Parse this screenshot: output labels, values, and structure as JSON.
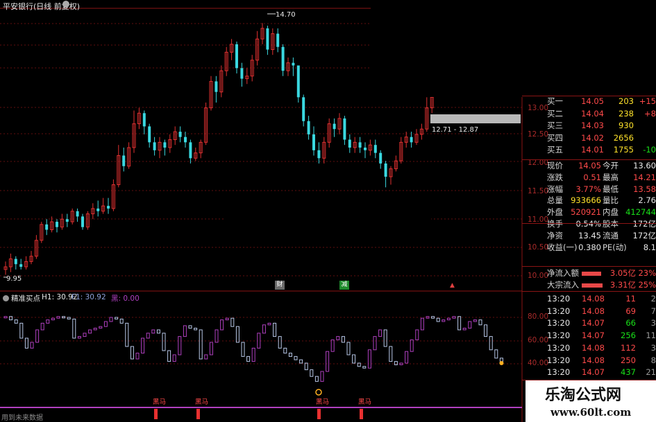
{
  "main": {
    "title": "平安银行(日线 前复权)",
    "high_marker": "14.70",
    "low_marker": "9.95",
    "range_marker": "12.71 - 12.87",
    "tags": [
      "财",
      "减",
      "▲"
    ],
    "price_axis": [
      "13.00",
      "12.50",
      "12.00",
      "11.50",
      "11.00",
      "10.50",
      "10.00"
    ]
  },
  "indicator": {
    "name": "精准买点",
    "h1": "H1: 30.92",
    "f1": "F1: 30.92",
    "hei": "黑: 0.00",
    "axis": [
      "80.00",
      "60.00",
      "40.00"
    ],
    "signals": [
      "黑马",
      "黑马",
      "黑马",
      "黑马"
    ],
    "footer": "用到未来数据"
  },
  "orderbook": {
    "rows": [
      {
        "label": "买一",
        "price": "14.05",
        "vol": "203",
        "chg": "+15"
      },
      {
        "label": "买二",
        "price": "14.04",
        "vol": "238",
        "chg": "+8"
      },
      {
        "label": "买三",
        "price": "14.03",
        "vol": "930",
        "chg": ""
      },
      {
        "label": "买四",
        "price": "14.02",
        "vol": "2656",
        "chg": ""
      },
      {
        "label": "买五",
        "price": "14.01",
        "vol": "1755",
        "chg": "-10"
      }
    ]
  },
  "quote": {
    "rows": [
      {
        "l1": "现价",
        "v1": "14.05",
        "l2": "今开",
        "v2": "13.60"
      },
      {
        "l1": "涨跌",
        "v1": "0.51",
        "l2": "最高",
        "v2": "14.21"
      },
      {
        "l1": "涨幅",
        "v1": "3.77%",
        "l2": "最低",
        "v2": "13.58"
      },
      {
        "l1": "总量",
        "v1": "933666",
        "l2": "量比",
        "v2": "2.76"
      },
      {
        "l1": "外盘",
        "v1": "520921",
        "l2": "内盘",
        "v2": "412744"
      },
      {
        "l1": "换手",
        "v1": "0.54%",
        "l2": "股本",
        "v2": "172亿"
      },
      {
        "l1": "净资",
        "v1": "13.45",
        "l2": "流通",
        "v2": "172亿"
      },
      {
        "l1": "收益(一)",
        "v1": "0.380",
        "l2": "PE(动)",
        "v2": "8.1"
      }
    ],
    "flow": [
      {
        "label": "净流入额",
        "value": "3.05亿",
        "pct": "23%"
      },
      {
        "label": "大宗流入",
        "value": "3.31亿",
        "pct": "25%"
      }
    ]
  },
  "ticks": {
    "rows": [
      {
        "time": "13:20",
        "price": "14.08",
        "vol": "11",
        "d": "2"
      },
      {
        "time": "13:20",
        "price": "14.08",
        "vol": "69",
        "d": "7"
      },
      {
        "time": "13:20",
        "price": "14.07",
        "vol": "66",
        "d": "3"
      },
      {
        "time": "13:20",
        "price": "14.07",
        "vol": "256",
        "d": "11"
      },
      {
        "time": "13:20",
        "price": "14.08",
        "vol": "112",
        "d": "3"
      },
      {
        "time": "13:20",
        "price": "14.08",
        "vol": "250",
        "d": "8"
      },
      {
        "time": "13:20",
        "price": "14.07",
        "vol": "437",
        "d": "21"
      }
    ]
  },
  "watermark": {
    "title": "乐淘公式网",
    "url": "www.60lt.com"
  },
  "colors": {
    "up": "#e03030",
    "down": "#3ad8e0",
    "grid": "#8b1414",
    "kdj_a": "#b040c0",
    "kdj_b": "#b8c8e8"
  },
  "chart_data": {
    "type": "candlestick",
    "ylim": [
      9.8,
      14.9
    ],
    "candles": [
      [
        10.05,
        10.1,
        10.2,
        9.95
      ],
      [
        10.1,
        10.25,
        10.35,
        10.0
      ],
      [
        10.25,
        10.15,
        10.3,
        10.05
      ],
      [
        10.15,
        10.1,
        10.25,
        10.05
      ],
      [
        10.1,
        10.2,
        10.3,
        10.05
      ],
      [
        10.2,
        10.3,
        10.4,
        10.15
      ],
      [
        10.3,
        10.6,
        10.7,
        10.25
      ],
      [
        10.6,
        10.9,
        10.95,
        10.55
      ],
      [
        10.9,
        10.8,
        11.0,
        10.7
      ],
      [
        10.8,
        10.95,
        11.05,
        10.75
      ],
      [
        10.95,
        10.85,
        11.0,
        10.75
      ],
      [
        10.85,
        11.0,
        11.1,
        10.8
      ],
      [
        11.0,
        10.95,
        11.1,
        10.85
      ],
      [
        10.95,
        11.15,
        11.2,
        10.9
      ],
      [
        11.15,
        11.05,
        11.2,
        10.95
      ],
      [
        11.05,
        10.85,
        11.1,
        10.8
      ],
      [
        10.85,
        11.1,
        11.15,
        10.8
      ],
      [
        11.1,
        11.2,
        11.3,
        11.0
      ],
      [
        11.2,
        11.15,
        11.35,
        11.05
      ],
      [
        11.15,
        11.25,
        11.4,
        11.1
      ],
      [
        11.25,
        11.2,
        11.4,
        11.1
      ],
      [
        11.2,
        11.65,
        11.75,
        11.15
      ],
      [
        11.65,
        12.2,
        12.4,
        11.6
      ],
      [
        12.2,
        12.0,
        12.35,
        11.9
      ],
      [
        12.0,
        12.35,
        12.45,
        11.95
      ],
      [
        12.35,
        12.8,
        13.05,
        12.25
      ],
      [
        12.8,
        13.0,
        13.1,
        12.7
      ],
      [
        13.0,
        12.75,
        13.05,
        12.6
      ],
      [
        12.75,
        12.45,
        12.8,
        12.35
      ],
      [
        12.45,
        12.3,
        12.55,
        12.2
      ],
      [
        12.3,
        12.45,
        12.55,
        12.15
      ],
      [
        12.45,
        12.35,
        12.5,
        12.2
      ],
      [
        12.35,
        12.5,
        12.6,
        12.25
      ],
      [
        12.5,
        12.65,
        12.75,
        12.4
      ],
      [
        12.65,
        12.55,
        12.75,
        12.45
      ],
      [
        12.55,
        12.45,
        12.65,
        12.35
      ],
      [
        12.45,
        12.15,
        12.5,
        12.05
      ],
      [
        12.15,
        12.25,
        12.35,
        12.1
      ],
      [
        12.25,
        12.45,
        12.5,
        12.15
      ],
      [
        12.45,
        13.1,
        13.2,
        12.4
      ],
      [
        13.1,
        13.6,
        13.7,
        13.05
      ],
      [
        13.6,
        13.4,
        13.7,
        13.2
      ],
      [
        13.4,
        13.8,
        13.9,
        13.3
      ],
      [
        13.8,
        14.15,
        14.25,
        13.7
      ],
      [
        14.15,
        14.3,
        14.4,
        14.0
      ],
      [
        14.3,
        13.85,
        14.35,
        13.75
      ],
      [
        13.85,
        13.65,
        13.95,
        13.5
      ],
      [
        13.65,
        13.7,
        13.85,
        13.55
      ],
      [
        13.7,
        14.0,
        14.1,
        13.6
      ],
      [
        14.0,
        14.4,
        14.55,
        13.9
      ],
      [
        14.4,
        14.6,
        14.7,
        14.3
      ],
      [
        14.6,
        14.2,
        14.65,
        14.1
      ],
      [
        14.2,
        14.5,
        14.6,
        14.1
      ],
      [
        14.5,
        14.25,
        14.6,
        14.15
      ],
      [
        14.25,
        13.8,
        14.3,
        13.7
      ],
      [
        13.8,
        13.95,
        14.05,
        13.7
      ],
      [
        13.95,
        13.9,
        14.05,
        13.7
      ],
      [
        13.9,
        13.3,
        13.4,
        13.2
      ],
      [
        13.3,
        12.85,
        13.35,
        12.75
      ],
      [
        12.85,
        12.6,
        12.95,
        12.5
      ],
      [
        12.6,
        12.3,
        12.75,
        12.2
      ],
      [
        12.3,
        12.15,
        12.45,
        12.05
      ],
      [
        12.15,
        12.45,
        12.55,
        12.05
      ],
      [
        12.45,
        12.8,
        12.9,
        12.35
      ],
      [
        12.8,
        12.7,
        12.9,
        12.55
      ],
      [
        12.7,
        12.9,
        13.0,
        12.6
      ],
      [
        12.9,
        12.5,
        12.95,
        12.4
      ],
      [
        12.5,
        12.35,
        12.6,
        12.25
      ],
      [
        12.35,
        12.45,
        12.55,
        12.25
      ],
      [
        12.45,
        12.35,
        12.55,
        12.25
      ],
      [
        12.35,
        12.3,
        12.45,
        12.15
      ],
      [
        12.3,
        12.4,
        12.5,
        12.2
      ],
      [
        12.4,
        12.25,
        12.5,
        12.15
      ],
      [
        12.25,
        12.05,
        12.3,
        11.95
      ],
      [
        12.05,
        11.8,
        12.1,
        11.6
      ],
      [
        11.8,
        11.95,
        12.0,
        11.65
      ],
      [
        11.95,
        12.1,
        12.2,
        11.9
      ],
      [
        12.1,
        12.45,
        12.55,
        12.05
      ],
      [
        12.45,
        12.55,
        12.65,
        12.35
      ],
      [
        12.55,
        12.45,
        12.65,
        12.35
      ],
      [
        12.45,
        12.6,
        12.7,
        12.4
      ],
      [
        12.6,
        12.7,
        12.8,
        12.5
      ],
      [
        12.7,
        13.1,
        13.3,
        12.65
      ],
      [
        13.1,
        13.3,
        13.45,
        13.0
      ]
    ],
    "kdj_line": [
      86,
      82,
      78,
      60,
      48,
      55,
      70,
      78,
      82,
      84,
      86,
      85,
      83,
      60,
      62,
      66,
      70,
      72,
      74,
      80,
      85,
      83,
      78,
      50,
      35,
      42,
      60,
      66,
      70,
      66,
      45,
      32,
      40,
      62,
      75,
      72,
      70,
      35,
      40,
      55,
      70,
      82,
      84,
      74,
      55,
      38,
      32,
      48,
      66,
      76,
      78,
      62,
      48,
      42,
      38,
      34,
      30,
      22,
      14,
      8,
      20,
      44,
      58,
      62,
      55,
      40,
      30,
      26,
      24,
      46,
      62,
      70,
      50,
      32,
      28,
      30,
      44,
      58,
      70,
      84,
      86,
      84,
      80,
      82,
      84,
      86,
      70,
      72,
      80,
      82,
      76,
      62,
      46,
      36,
      30
    ]
  }
}
